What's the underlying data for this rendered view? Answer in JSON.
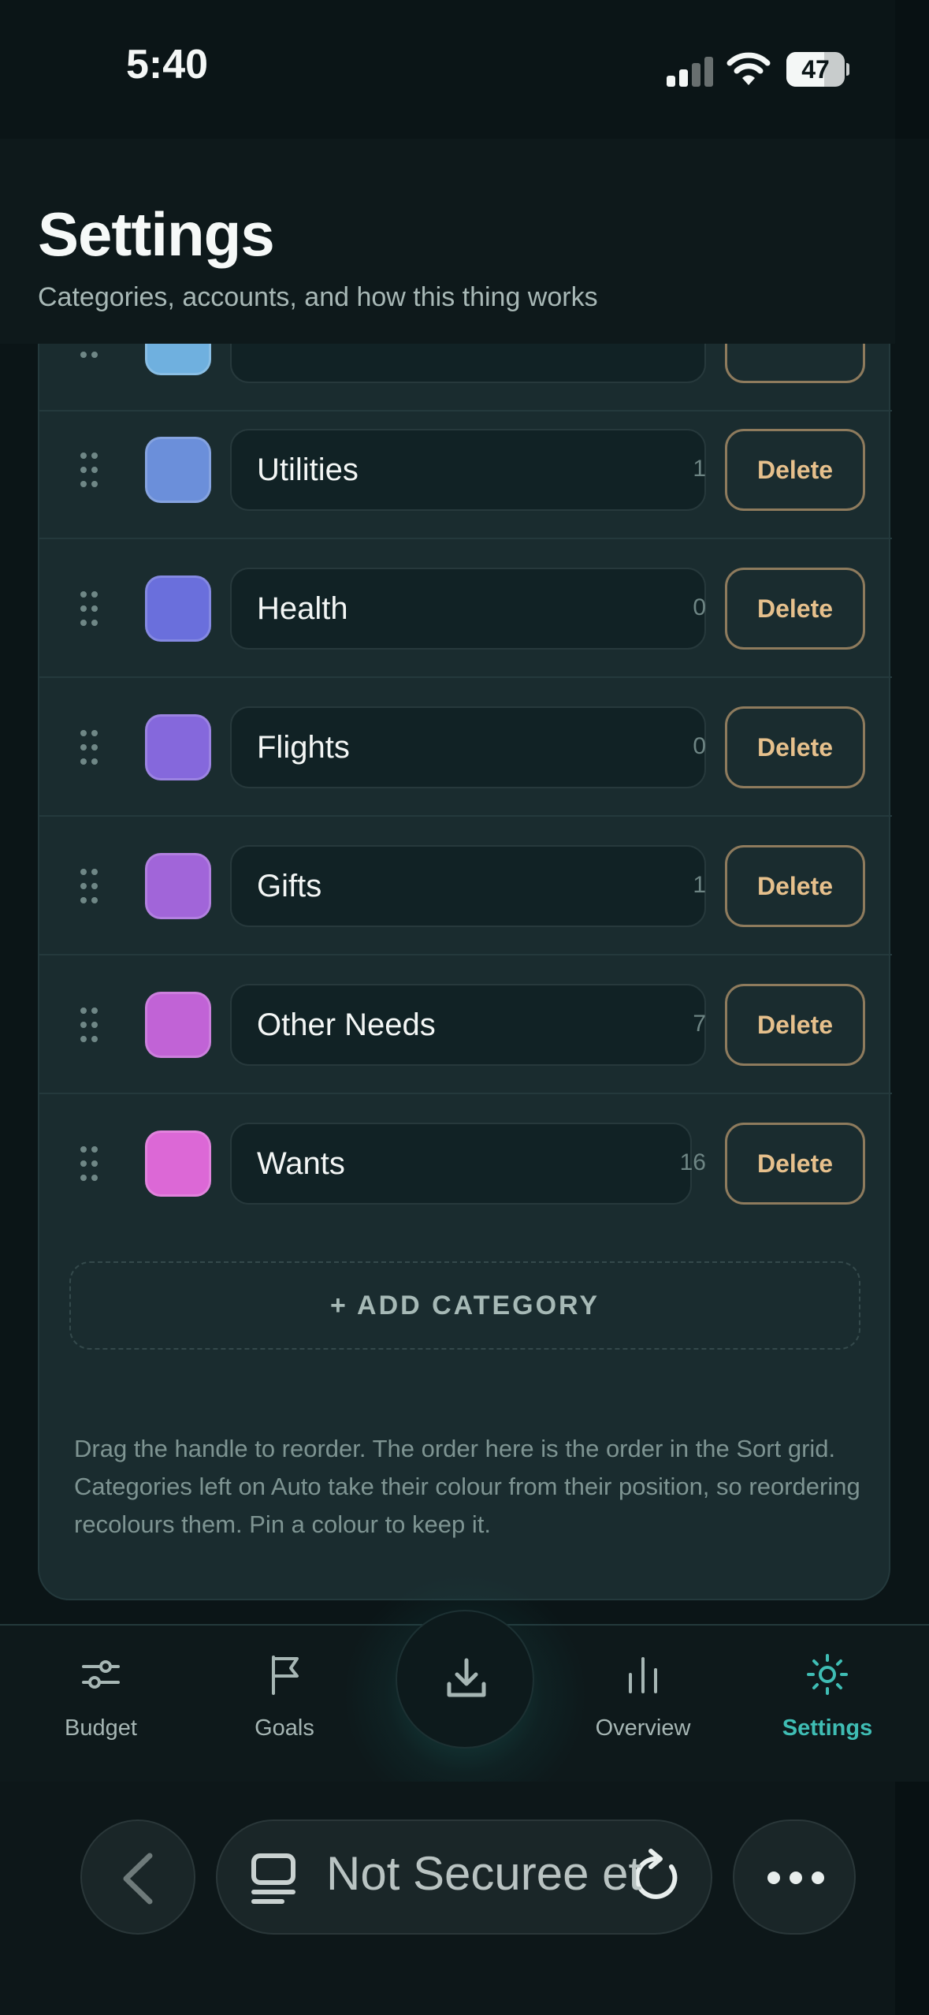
{
  "status_bar": {
    "time": "5:40",
    "battery": "47"
  },
  "header": {
    "title": "Settings",
    "subtitle": "Categories, accounts, and how this thing works"
  },
  "categories": [
    {
      "name": "",
      "count": "",
      "delete_label": "",
      "color": "#6fb0df"
    },
    {
      "name": "Utilities",
      "count": "1",
      "delete_label": "Delete",
      "color": "#6b8fda"
    },
    {
      "name": "Health",
      "count": "0",
      "delete_label": "Delete",
      "color": "#6a6fdc"
    },
    {
      "name": "Flights",
      "count": "0",
      "delete_label": "Delete",
      "color": "#8568dc"
    },
    {
      "name": "Gifts",
      "count": "1",
      "delete_label": "Delete",
      "color": "#a165d9"
    },
    {
      "name": "Other Needs",
      "count": "7",
      "delete_label": "Delete",
      "color": "#c163d6"
    },
    {
      "name": "Wants",
      "count": "16",
      "delete_label": "Delete",
      "color": "#dc68d6"
    }
  ],
  "add_category_label": "+ ADD CATEGORY",
  "help_text": "Drag the handle to reorder. The order here is the order in the Sort grid. Categories left on Auto take their colour from their position, so reordering recolours them. Pin a colour to keep it.",
  "nav": {
    "items": [
      {
        "label": "Budget",
        "icon": "sliders-icon"
      },
      {
        "label": "Goals",
        "icon": "flag-icon"
      },
      {
        "label": "",
        "icon": "download-icon"
      },
      {
        "label": "Overview",
        "icon": "bar-chart-icon"
      },
      {
        "label": "Settings",
        "icon": "sun-gear-icon"
      }
    ],
    "active": "Settings",
    "accent_color": "#3fbdb4"
  },
  "browser": {
    "url_text": "Not Securee et"
  }
}
